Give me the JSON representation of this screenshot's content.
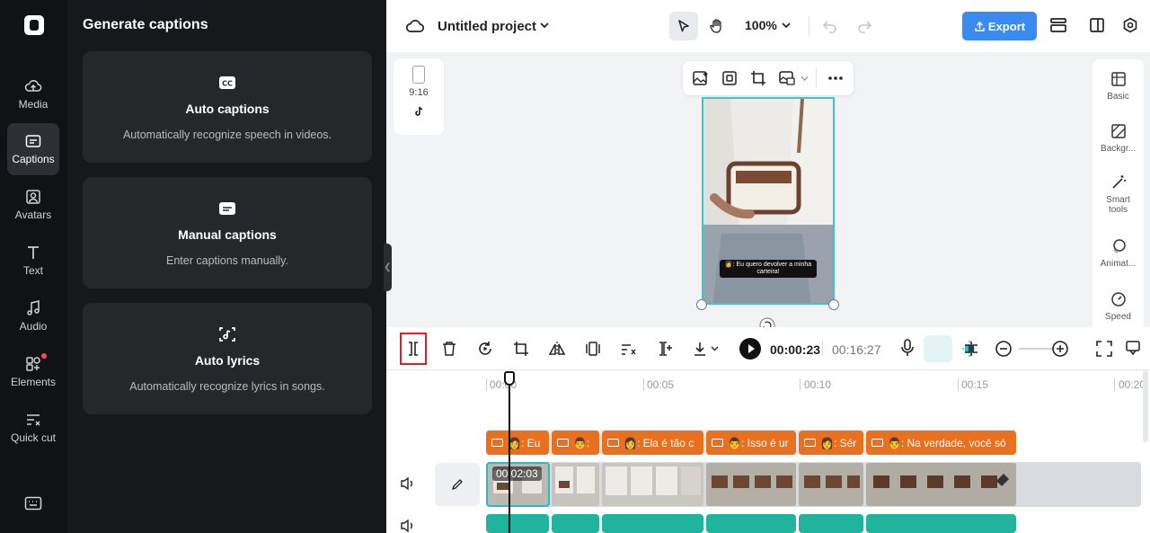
{
  "rail": {
    "items": [
      {
        "label": "Media"
      },
      {
        "label": "Captions"
      },
      {
        "label": "Avatars"
      },
      {
        "label": "Text"
      },
      {
        "label": "Audio"
      },
      {
        "label": "Elements"
      },
      {
        "label": "Quick cut"
      }
    ]
  },
  "panel": {
    "title": "Generate captions",
    "cards": [
      {
        "title": "Auto captions",
        "desc": "Automatically recognize speech in videos."
      },
      {
        "title": "Manual captions",
        "desc": "Enter captions manually."
      },
      {
        "title": "Auto lyrics",
        "desc": "Automatically recognize lyrics in songs."
      }
    ]
  },
  "topbar": {
    "project_title": "Untitled project",
    "zoom": "100%",
    "export_label": "Export"
  },
  "canvas": {
    "ratio_label": "9:16",
    "subtitle_text": "👩: Eu quero devolver a minha carteira!"
  },
  "right_panel": {
    "items": [
      {
        "label": "Basic"
      },
      {
        "label": "Backgr..."
      },
      {
        "label": "Smart tools"
      },
      {
        "label": "Animat..."
      },
      {
        "label": "Speed"
      }
    ]
  },
  "timeline": {
    "current_time": "00:00:23",
    "total_time": "00:16:27",
    "ruler": [
      "00:00",
      "00:05",
      "00:10",
      "00:15",
      "00:20"
    ],
    "clip_time": "00:02:03",
    "captions": [
      "👩: Eu",
      "👨: ",
      "👩: Ela é tão c",
      "👨: Isso é ur",
      "👩: Sér",
      "👨: Na verdade, você só"
    ]
  },
  "colors": {
    "accent": "#3a8bf0",
    "caption_orange": "#e8701f",
    "audio_teal": "#20b39e",
    "selection_cyan": "#2bb8c7",
    "highlight_red": "#e02020"
  }
}
